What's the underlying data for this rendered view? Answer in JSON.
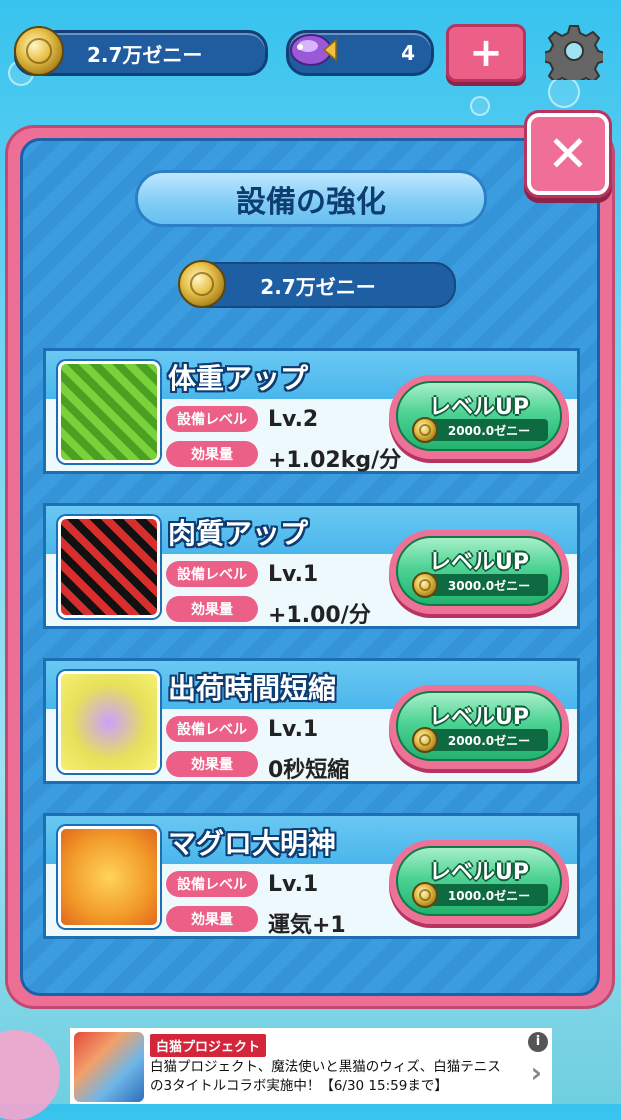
{
  "topbar": {
    "currency_label": "2.7万ゼニー",
    "gem_count": "4",
    "plus_label": "+"
  },
  "dialog": {
    "title": "設備の強化",
    "balance": "2.7万ゼニー",
    "close_label": "✕",
    "level_tag": "設備レベル",
    "effect_tag": "効果量",
    "upgrade_label": "レベルUP",
    "items": [
      {
        "name": "体重アップ",
        "level": "Lv.2",
        "effect": "+1.02kg/分",
        "cost": "2000.0ゼニー"
      },
      {
        "name": "肉質アップ",
        "level": "Lv.1",
        "effect": "+1.00/分",
        "cost": "3000.0ゼニー"
      },
      {
        "name": "出荷時間短縮",
        "level": "Lv.1",
        "effect": "0秒短縮",
        "cost": "2000.0ゼニー"
      },
      {
        "name": "マグロ大明神",
        "level": "Lv.1",
        "effect": "運気+1",
        "cost": "1000.0ゼニー"
      }
    ]
  },
  "ad": {
    "badge": "白猫プロジェクト",
    "text": "白猫プロジェクト、魔法使いと黒猫のウィズ、白猫テニスの3タイトルコラボ実施中！【6/30 15:59まで】",
    "info": "i",
    "arrow": "›"
  },
  "colors": {
    "accent_pink": "#ec5f87",
    "panel_blue": "#3b9de0",
    "button_green": "#4ed394",
    "dark_blue": "#1e5ea3"
  }
}
